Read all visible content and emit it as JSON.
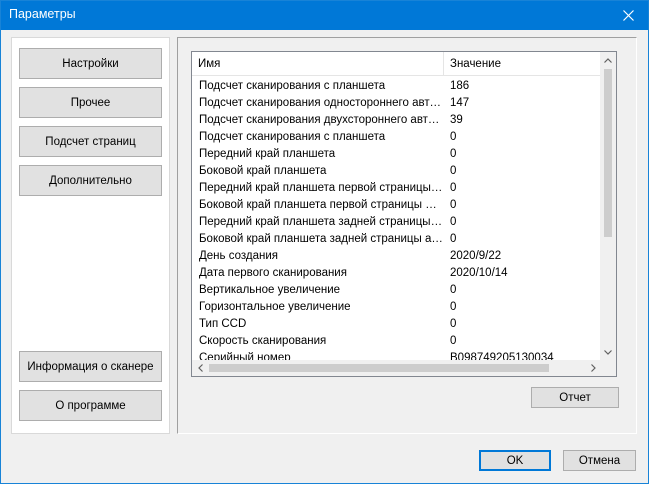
{
  "window": {
    "title": "Параметры",
    "close_icon": "close-icon"
  },
  "nav": {
    "settings": "Настройки",
    "other": "Прочее",
    "page_count": "Подсчет страниц",
    "advanced": "Дополнительно",
    "scanner_info": "Информация о сканере",
    "about": "О программе"
  },
  "table": {
    "headers": [
      "Имя",
      "Значение"
    ],
    "rows": [
      [
        "Подсчет сканирования с планшета",
        "186"
      ],
      [
        "Подсчет сканирования одностороннего автоподатчика",
        "147"
      ],
      [
        "Подсчет сканирования двухстороннего автоподатчика",
        "39"
      ],
      [
        "Подсчет сканирования с планшета",
        "0"
      ],
      [
        "Передний край планшета",
        "0"
      ],
      [
        "Боковой край планшета",
        "0"
      ],
      [
        "Передний край планшета первой страницы автоподатчика",
        "0"
      ],
      [
        "Боковой край планшета первой страницы автоподатчика",
        "0"
      ],
      [
        "Передний край планшета задней страницы автоподатчика",
        "0"
      ],
      [
        "Боковой край планшета задней страницы автоподатчика",
        "0"
      ],
      [
        "День создания",
        "2020/9/22"
      ],
      [
        "Дата первого сканирования",
        "2020/10/14"
      ],
      [
        "Вертикальное увеличение",
        "0"
      ],
      [
        "Горизонтальное увеличение",
        "0"
      ],
      [
        "Тип CCD",
        "0"
      ],
      [
        "Скорость сканирования",
        "0"
      ],
      [
        "Серийный номер",
        "B098749205130034"
      ]
    ]
  },
  "buttons": {
    "report": "Отчет",
    "ok": "OK",
    "cancel": "Отмена"
  },
  "colors": {
    "titlebar": "#0078d7",
    "default_button_border": "#0078d7"
  }
}
